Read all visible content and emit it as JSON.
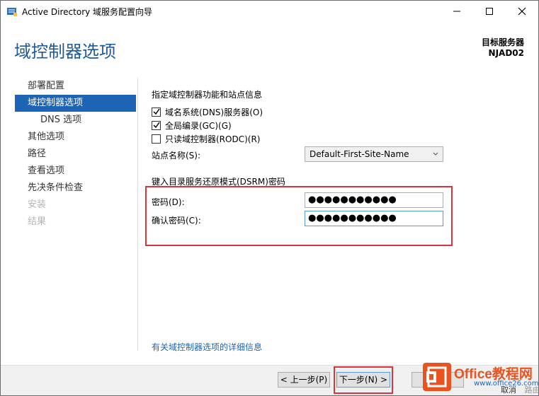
{
  "window": {
    "title": "Active Directory 域服务配置向导",
    "controls": [
      "minimize-icon",
      "maximize-icon",
      "close-icon"
    ]
  },
  "header": {
    "page_title": "域控制器选项",
    "server_label": "目标服务器",
    "server_name": "NJAD02"
  },
  "nav": {
    "items": [
      {
        "label": "部署配置",
        "state": "normal"
      },
      {
        "label": "域控制器选项",
        "state": "active"
      },
      {
        "label": "DNS 选项",
        "state": "sub"
      },
      {
        "label": "其他选项",
        "state": "normal"
      },
      {
        "label": "路径",
        "state": "normal"
      },
      {
        "label": "查看选项",
        "state": "normal"
      },
      {
        "label": "先决条件检查",
        "state": "normal"
      },
      {
        "label": "安装",
        "state": "disabled"
      },
      {
        "label": "结果",
        "state": "disabled"
      }
    ]
  },
  "main": {
    "section1_label": "指定域控制器功能和站点信息",
    "checkboxes": [
      {
        "label": "域名系统(DNS)服务器(O)",
        "checked": true
      },
      {
        "label": "全局编录(GC)(G)",
        "checked": true
      },
      {
        "label": "只读域控制器(RODC)(R)",
        "checked": false
      }
    ],
    "site_label": "站点名称(S):",
    "site_value": "Default-First-Site-Name",
    "section2_label": "键入目录服务还原模式(DSRM)密码",
    "password_label": "密码(D):",
    "password_value": "●●●●●●●●●●●",
    "confirm_label": "确认密码(C):",
    "confirm_value": "●●●●●●●●●●●",
    "more_link": "有关域控制器选项的详细信息"
  },
  "footer": {
    "prev_label": "< 上一步(P)",
    "next_label": "下一步(N) >",
    "cancel_label": "取消"
  },
  "watermark": {
    "brand": "Office教程网",
    "url": "www.office26.com",
    "site": "路由网"
  },
  "colors": {
    "accent": "#1e64b4",
    "title_blue": "#1e5a9a",
    "highlight_red": "#d9343e",
    "watermark_orange": "#e8531f"
  }
}
